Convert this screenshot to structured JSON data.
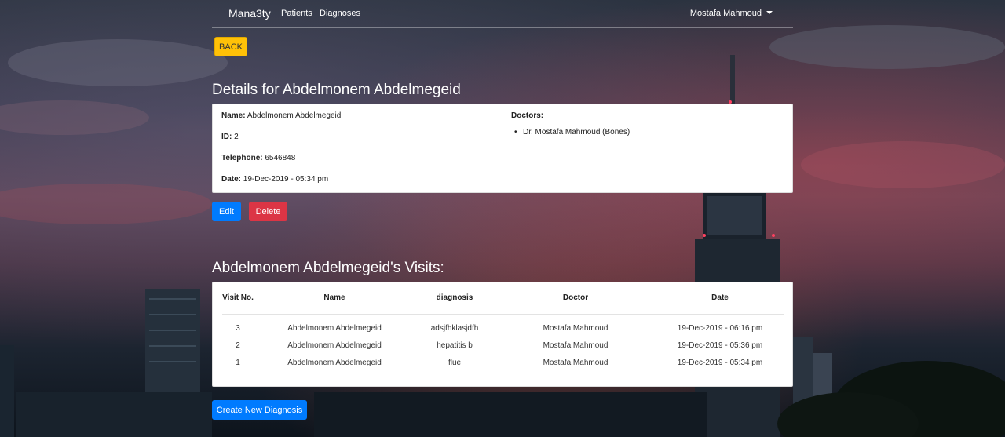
{
  "navbar": {
    "brand": "Mana3ty",
    "links": [
      "Patients",
      "Diagnoses"
    ],
    "user": "Mostafa Mahmoud"
  },
  "back_label": "BACK",
  "details": {
    "heading": "Details for Abdelmonem Abdelmegeid",
    "name_label": "Name:",
    "name": "Abdelmonem Abdelmegeid",
    "id_label": "ID:",
    "id": "2",
    "telephone_label": "Telephone:",
    "telephone": "6546848",
    "date_label": "Date:",
    "date": "19-Dec-2019 - 05:34 pm",
    "doctors_label": "Doctors:",
    "doctors": [
      "Dr. Mostafa Mahmoud (Bones)"
    ]
  },
  "actions": {
    "edit": "Edit",
    "delete": "Delete"
  },
  "visits": {
    "heading": "Abdelmonem Abdelmegeid's Visits:",
    "columns": [
      "Visit No.",
      "Name",
      "diagnosis",
      "Doctor",
      "Date"
    ],
    "rows": [
      [
        "3",
        "Abdelmonem Abdelmegeid",
        "adsjfhklasjdfh",
        "Mostafa Mahmoud",
        "19-Dec-2019 - 06:16 pm"
      ],
      [
        "2",
        "Abdelmonem Abdelmegeid",
        "hepatitis b",
        "Mostafa Mahmoud",
        "19-Dec-2019 - 05:36 pm"
      ],
      [
        "1",
        "Abdelmonem Abdelmegeid",
        "flue",
        "Mostafa Mahmoud",
        "19-Dec-2019 - 05:34 pm"
      ]
    ]
  },
  "create_label": "Create New Diagnosis",
  "colors": {
    "primary": "#007bff",
    "danger": "#dc3545",
    "warning": "#ffc107"
  }
}
